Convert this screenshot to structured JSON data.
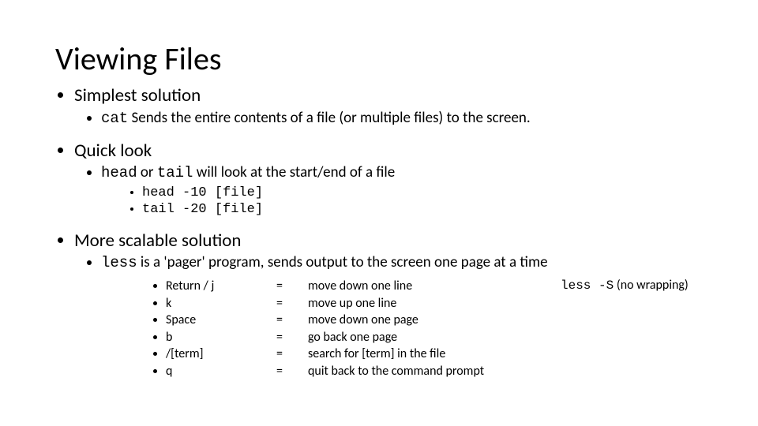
{
  "title": "Viewing Files",
  "sections": [
    {
      "heading": "Simplest solution",
      "sub": {
        "cmd": "cat",
        "text": " Sends the entire contents of a file (or multiple files) to the screen."
      }
    },
    {
      "heading": "Quick look",
      "sub": {
        "cmd1": "head",
        "mid": " or ",
        "cmd2": "tail",
        "text": " will look at the start/end of a file"
      },
      "examples": [
        "head -10 [file]",
        "tail -20 [file]"
      ]
    },
    {
      "heading": "More scalable solution",
      "sub": {
        "cmd": "less",
        "text": " is a 'pager' program, sends output to the screen one page at a time"
      },
      "keys": [
        {
          "k": "Return / j",
          "d": "move down one line"
        },
        {
          "k": "k",
          "d": "move up one line"
        },
        {
          "k": "Space",
          "d": "move down one page"
        },
        {
          "k": "b",
          "d": "go back one page"
        },
        {
          "k": "/[term]",
          "d": "search for [term] in the file"
        },
        {
          "k": "q",
          "d": "quit back to the command prompt"
        }
      ],
      "note_cmd": "less -S",
      "note_text": "  (no wrapping)"
    }
  ],
  "eq": "="
}
